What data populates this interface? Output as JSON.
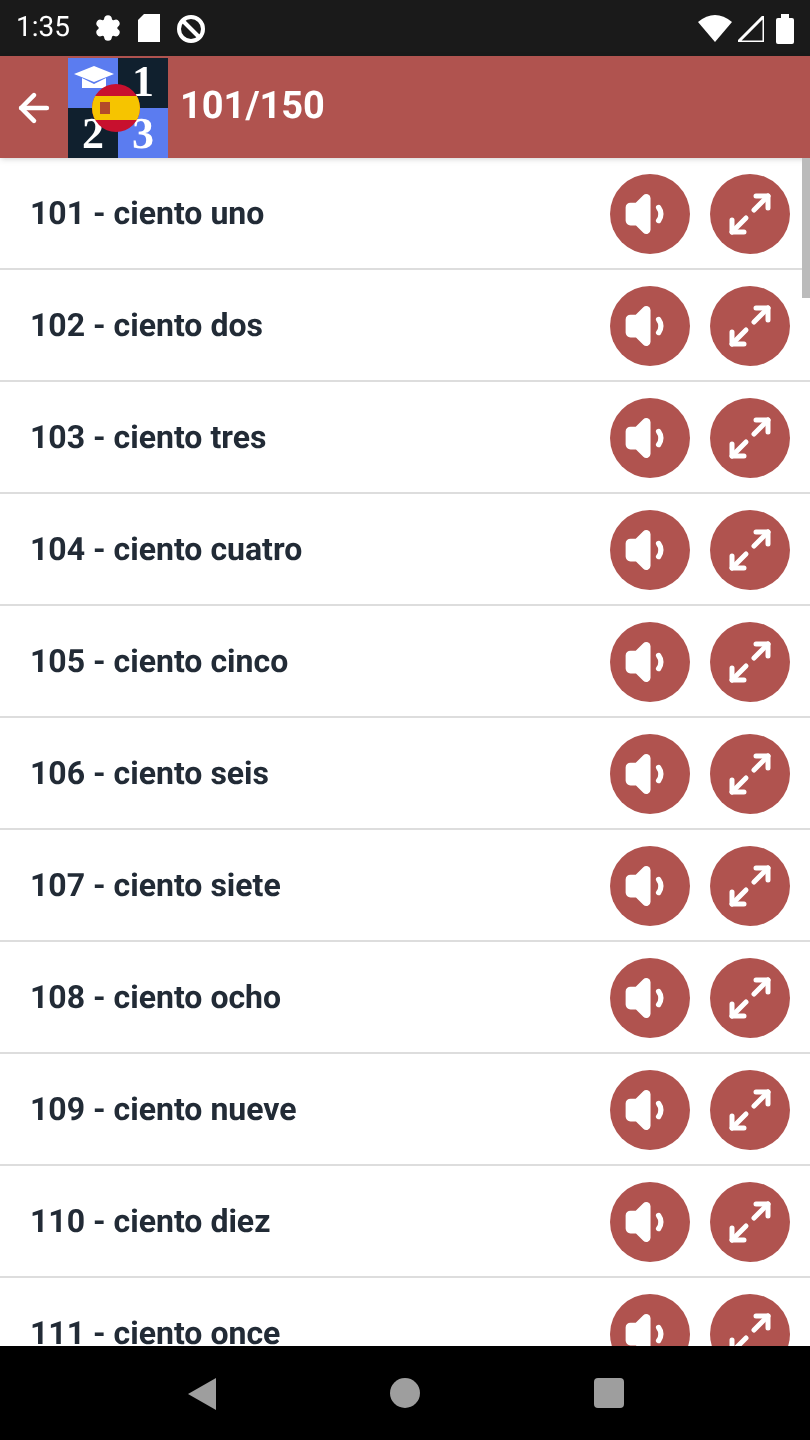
{
  "status_bar": {
    "time": "1:35"
  },
  "header": {
    "title": "101/150",
    "logo_digits": [
      "1",
      "2",
      "3"
    ]
  },
  "rows": [
    {
      "text": "101 - ciento uno"
    },
    {
      "text": "102 - ciento dos"
    },
    {
      "text": "103 - ciento tres"
    },
    {
      "text": "104 - ciento cuatro"
    },
    {
      "text": "105 - ciento cinco"
    },
    {
      "text": "106 - ciento seis"
    },
    {
      "text": "107 - ciento siete"
    },
    {
      "text": "108 - ciento ocho"
    },
    {
      "text": "109 - ciento nueve"
    },
    {
      "text": "110 - ciento diez"
    },
    {
      "text": "111 - ciento once"
    }
  ]
}
